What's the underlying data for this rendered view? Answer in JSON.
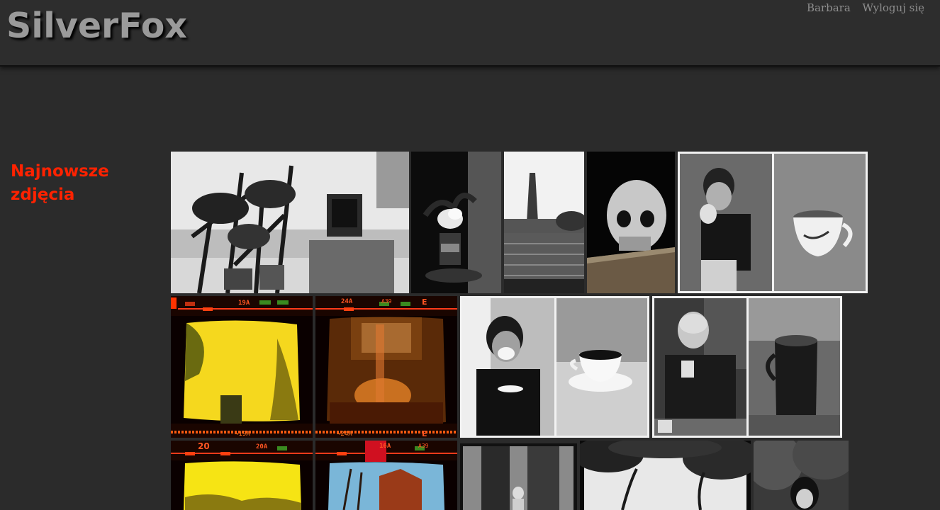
{
  "header": {
    "logo": "SilverFox",
    "user_name": "Barbara",
    "logout_label": "Wyloguj się"
  },
  "section": {
    "title": "Najnowsze zdjęcia"
  },
  "film_labels": {
    "a_top": "19A",
    "a_bottom": "→19A",
    "b_top": "24A",
    "b_code": "A39",
    "b_bottom": "→24A",
    "b_letter": "E",
    "c_top_left": "20",
    "c_top": "20A",
    "d_top": "16A",
    "d_code": "A39"
  },
  "colors": {
    "accent": "#ff2200",
    "background": "#2b2b2b"
  }
}
